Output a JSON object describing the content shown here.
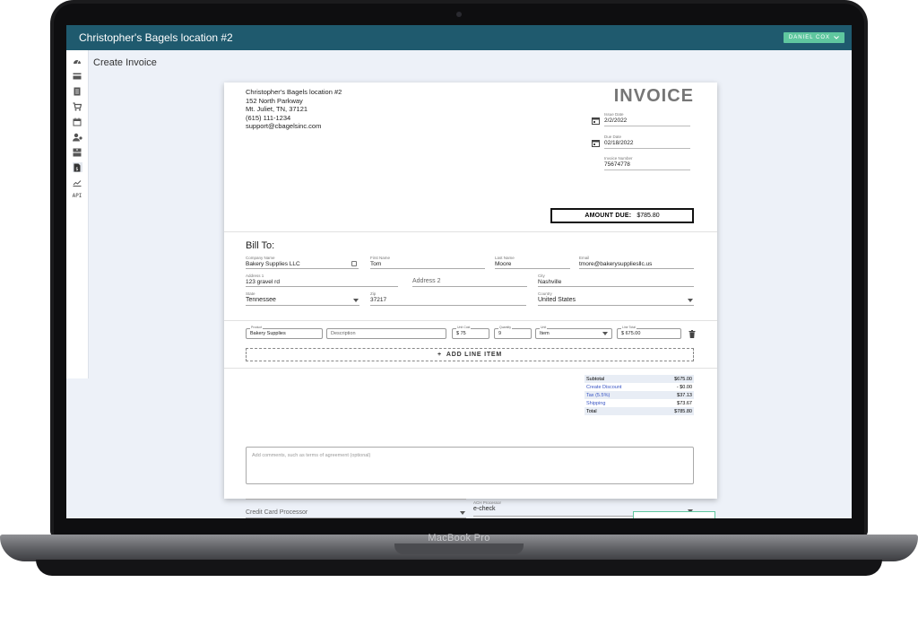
{
  "device": {
    "brand": "MacBook Pro"
  },
  "app": {
    "title": "Christopher's Bagels location #2",
    "user": "DANIEL COX"
  },
  "sidebar": {
    "api_label": "API"
  },
  "page": {
    "title": "Create Invoice"
  },
  "business": {
    "name": "Christopher's Bagels location #2",
    "street": "152 North Parkway",
    "city_line": "Mt. Juliet, TN, 37121",
    "phone": "(615) 111-1234",
    "email": "support@cbagelsinc.com"
  },
  "invoice": {
    "title": "INVOICE",
    "issue_date_label": "Issue Date",
    "issue_date": "2/2/2022",
    "due_date_label": "Due Date",
    "due_date": "02/18/2022",
    "number_label": "Invoice Number",
    "number": "75674778",
    "amount_due_label": "AMOUNT DUE:",
    "amount_due": "$785.80"
  },
  "bill_to": {
    "heading": "Bill To:",
    "company_label": "Company Name",
    "company": "Bakery Supplies LLC",
    "first_label": "First Name",
    "first": "Tom",
    "last_label": "Last Name",
    "last": "Moore",
    "email_label": "Email",
    "email": "tmore@bakerysuppliesllc.us",
    "address1_label": "Address 1",
    "address1": "123 gravel rd",
    "address2_placeholder": "Address 2",
    "city_label": "City",
    "city": "Nashville",
    "state_label": "State",
    "state": "Tennessee",
    "zip_label": "Zip",
    "zip": "37217",
    "country_label": "Country",
    "country": "United States"
  },
  "line_item": {
    "product_label": "Product",
    "product": "Bakery Supplies",
    "description_placeholder": "Description",
    "unit_cost_label": "Unit Cost",
    "unit_cost": "$ 75",
    "quantity_label": "Quantity",
    "quantity": "9",
    "unit_label": "Unit",
    "unit": "Item",
    "line_total_label": "Line Total",
    "line_total": "$ 675.00"
  },
  "add_line_label": "ADD LINE ITEM",
  "totals": [
    {
      "label": "Subtotal",
      "value": "$675.00",
      "link": false
    },
    {
      "label": "Create Discount",
      "value": "- $0.00",
      "link": true
    },
    {
      "label": "Tax (5.5%)",
      "value": "$37.13",
      "link": true
    },
    {
      "label": "Shipping",
      "value": "$73.67",
      "link": true
    },
    {
      "label": "Total",
      "value": "$785.80",
      "link": false
    }
  ],
  "comments_placeholder": "Add comments, such as terms of agreement (optional)",
  "payment": {
    "cc_placeholder": "Credit Card Processor",
    "ach_label": "ACH Processor",
    "ach": "e-check"
  },
  "colors": {
    "appbar": "#1f5a6e",
    "user_chip": "#5fc79f",
    "link": "#3a56c5",
    "screen_bg": "#edf1f8"
  }
}
